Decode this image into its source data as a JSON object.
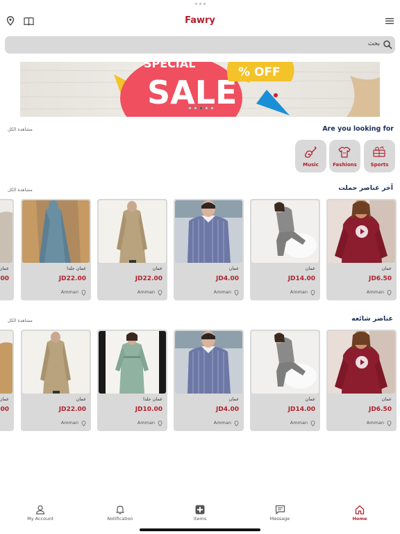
{
  "header": {
    "brand": "Fawry",
    "left_icons": [
      "location-pin-icon",
      "book-icon"
    ],
    "right_icon": "hamburger-menu-icon"
  },
  "search": {
    "text": "بحث",
    "icon": "search-icon"
  },
  "banner": {
    "text_top": "SPECIAL",
    "text_main": "SALE",
    "text_off": "% OFF",
    "slides": 5,
    "active_slide": 2
  },
  "categories_section": {
    "title": "Are you looking for",
    "view_all": "مشاهدة الكل",
    "items": [
      {
        "label": "Sports",
        "icon": "sports-icon"
      },
      {
        "label": "Fashions",
        "icon": "shirt-icon"
      },
      {
        "label": "Music",
        "icon": "guitar-icon"
      }
    ]
  },
  "latest_section": {
    "title": "آخر عناصر حملت",
    "view_all": "مشاهدة الكل",
    "cards": [
      {
        "subtitle": "عمان",
        "price": "JD6.50",
        "location": "Amman",
        "photo": "red-top",
        "video": true
      },
      {
        "subtitle": "عمان",
        "price": "JD14.00",
        "location": "Amman",
        "photo": "grey-set",
        "video": false
      },
      {
        "subtitle": "عمان",
        "price": "JD4.00",
        "location": "Amman",
        "photo": "striped-shirt",
        "video": false
      },
      {
        "subtitle": "عمان",
        "price": "JD22.00",
        "location": "Amman",
        "photo": "beige-abaya",
        "video": false
      },
      {
        "subtitle": "عمان جلدا",
        "price": "JD22.00",
        "location": "Amman",
        "photo": "blue-abaya",
        "video": false
      },
      {
        "subtitle": "عمان",
        "price": ".00",
        "location": "",
        "photo": "partial",
        "video": false
      }
    ]
  },
  "popular_section": {
    "title": "عناصر شائعه",
    "view_all": "مشاهدة الكل",
    "cards": [
      {
        "subtitle": "عمان",
        "price": "JD6.50",
        "location": "Amman",
        "photo": "red-top",
        "video": true
      },
      {
        "subtitle": "عمان",
        "price": "JD14.00",
        "location": "Amman",
        "photo": "grey-set",
        "video": false
      },
      {
        "subtitle": "عمان",
        "price": "JD4.00",
        "location": "Amman",
        "photo": "striped-shirt",
        "video": false
      },
      {
        "subtitle": "عمان جلدا",
        "price": "JD10.00",
        "location": "Amman",
        "photo": "green-dress",
        "video": false
      },
      {
        "subtitle": "عمان",
        "price": "JD22.00",
        "location": "Amman",
        "photo": "beige-abaya",
        "video": false
      },
      {
        "subtitle": "عمان",
        "price": ".00",
        "location": "",
        "photo": "partial",
        "video": false
      }
    ]
  },
  "bottom_nav": [
    {
      "label": "My Account",
      "icon": "user-icon",
      "active": false
    },
    {
      "label": "Notification",
      "icon": "bell-icon",
      "active": false
    },
    {
      "label": "Items",
      "icon": "plus-box-icon",
      "active": false
    },
    {
      "label": "Message",
      "icon": "message-icon",
      "active": false
    },
    {
      "label": "Home",
      "icon": "home-icon",
      "active": true
    }
  ],
  "colors": {
    "brand": "#b3202e",
    "title": "#1a2f5a",
    "card": "#d9d9d9"
  }
}
